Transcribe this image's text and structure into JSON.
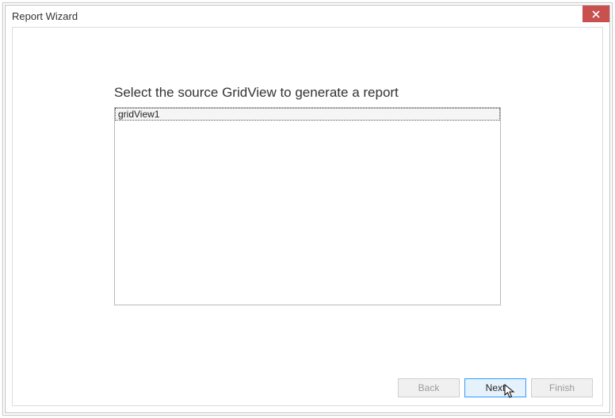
{
  "window": {
    "title": "Report Wizard"
  },
  "main": {
    "instruction": "Select the source GridView to generate a report",
    "list_items": [
      "gridView1"
    ],
    "selected_index": 0
  },
  "buttons": {
    "back": "Back",
    "next": "Next",
    "finish": "Finish"
  }
}
